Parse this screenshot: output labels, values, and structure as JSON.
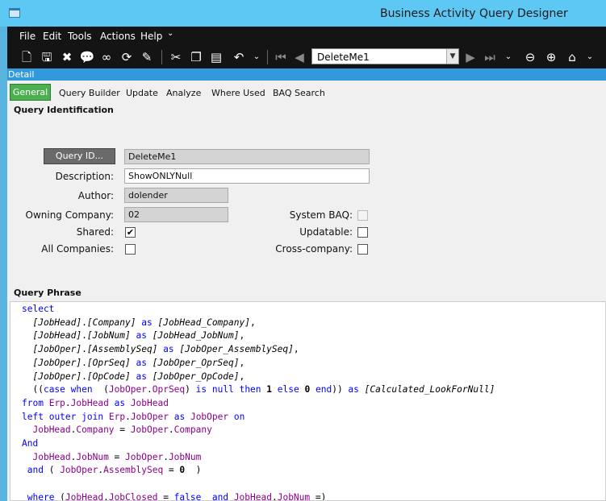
{
  "window": {
    "title": "Business Activity Query Designer"
  },
  "menu": [
    "File",
    "Edit",
    "Tools",
    "Actions",
    "Help"
  ],
  "toolbar": {
    "record_selector_value": "DeleteMe1"
  },
  "detail_bar_label": "Detail",
  "tabs": [
    "General",
    "Query Builder",
    "Update",
    "Analyze",
    "Where Used",
    "BAQ Search"
  ],
  "query_identification": {
    "section_title": "Query Identification",
    "query_id_button": "Query ID...",
    "query_id": "DeleteMe1",
    "description_label": "Description:",
    "description": "ShowONLYNull",
    "author_label": "Author:",
    "author": "dolender",
    "owning_company_label": "Owning Company:",
    "owning_company": "02",
    "shared_label": "Shared:",
    "shared_checked": true,
    "all_companies_label": "All Companies:",
    "all_companies_checked": false,
    "system_baq_label": "System BAQ:",
    "system_baq_checked": false,
    "updatable_label": "Updatable:",
    "updatable_checked": false,
    "cross_company_label": "Cross-company:",
    "cross_company_checked": false
  },
  "query_phrase": {
    "section_title": "Query Phrase",
    "lines": [
      "select",
      "  [JobHead].[Company] as [JobHead_Company],",
      "  [JobHead].[JobNum] as [JobHead_JobNum],",
      "  [JobOper].[AssemblySeq] as [JobOper_AssemblySeq],",
      "  [JobOper].[OprSeq] as [JobOper_OprSeq],",
      "  [JobOper].[OpCode] as [JobOper_OpCode],",
      "  ((case when  (JobOper.OprSeq) is null then 1 else 0 end)) as [Calculated_LookForNull]",
      "from Erp.JobHead as JobHead",
      "left outer join Erp.JobOper as JobOper on",
      "  JobHead.Company = JobOper.Company",
      "And",
      "  JobHead.JobNum = JobOper.JobNum",
      " and ( JobOper.AssemblySeq = 0  )",
      "",
      " where (JobHead.JobClosed = false  and JobHead.JobNum =)"
    ]
  }
}
